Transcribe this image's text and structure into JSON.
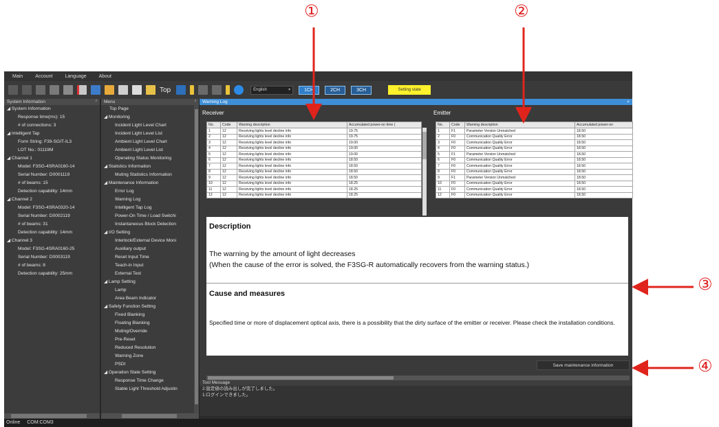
{
  "annotations": {
    "marker1": "①",
    "marker2": "②",
    "marker3": "③",
    "marker4": "④",
    "arrow_color": "#e0241c"
  },
  "menubar": {
    "items": [
      "Main",
      "Account",
      "Language",
      "About"
    ]
  },
  "toolbar": {
    "top_label": "Top",
    "language": "English",
    "ch1": "1CH",
    "ch2": "2CH",
    "ch3": "3CH",
    "setting_state": "Setting state"
  },
  "system_panel": {
    "title": "System Information",
    "items": [
      {
        "text": "◢ System Information",
        "indent": 0
      },
      {
        "text": "Response time(ms): 15",
        "indent": 2
      },
      {
        "text": "# of connections: 3",
        "indent": 2
      },
      {
        "text": "◢ Intelligent Tap",
        "indent": 0
      },
      {
        "text": "Form String: F39-SGIT-IL3",
        "indent": 2
      },
      {
        "text": "LOT No.: 01119M",
        "indent": 2
      },
      {
        "text": "◢ Channel 1",
        "indent": 0
      },
      {
        "text": "Model: F3SG-4SRA0160-14",
        "indent": 2
      },
      {
        "text": "Serial Number: D0001119",
        "indent": 2
      },
      {
        "text": "# of beams: 15",
        "indent": 2
      },
      {
        "text": "Detection capability: 14mm",
        "indent": 2
      },
      {
        "text": "◢ Channel 2",
        "indent": 0
      },
      {
        "text": "Model: F3SG-4SRA0320-14",
        "indent": 2
      },
      {
        "text": "Serial Number: D0002119",
        "indent": 2
      },
      {
        "text": "# of beams: 31",
        "indent": 2
      },
      {
        "text": "Detection capability: 14mm",
        "indent": 2
      },
      {
        "text": "◢ Channel 3",
        "indent": 0
      },
      {
        "text": "Model: F3SG-4SRA0160-25",
        "indent": 2
      },
      {
        "text": "Serial Number: D0003119",
        "indent": 2
      },
      {
        "text": "# of beams: 8",
        "indent": 2
      },
      {
        "text": "Detection capability: 25mm",
        "indent": 2
      }
    ]
  },
  "menu_panel": {
    "title": "Menu",
    "items": [
      {
        "text": "Top Page",
        "indent": 1
      },
      {
        "text": "◢ Monitoring",
        "indent": 0
      },
      {
        "text": "Incident Light Level Chart",
        "indent": 2
      },
      {
        "text": "Incident Light Level List",
        "indent": 2
      },
      {
        "text": "Ambient Light Level Chart",
        "indent": 2
      },
      {
        "text": "Ambient Light Level List",
        "indent": 2
      },
      {
        "text": "Operating Status Monitoring",
        "indent": 2
      },
      {
        "text": "◢ Statistics Information",
        "indent": 0
      },
      {
        "text": "Muting Statistics Information",
        "indent": 2
      },
      {
        "text": "◢ Maintenance Information",
        "indent": 0
      },
      {
        "text": "Error Log",
        "indent": 2
      },
      {
        "text": "Warning Log",
        "indent": 2
      },
      {
        "text": "Intelligent Tap Log",
        "indent": 2
      },
      {
        "text": "Power-On Time / Load Switchi",
        "indent": 2
      },
      {
        "text": "Instantaneous Block Detection",
        "indent": 2
      },
      {
        "text": "◢ I/O Setting",
        "indent": 0
      },
      {
        "text": "Interlock/External Device Moni",
        "indent": 2
      },
      {
        "text": "Auxiliary output",
        "indent": 2
      },
      {
        "text": "Reset Input Time",
        "indent": 2
      },
      {
        "text": "Teach-in Input",
        "indent": 2
      },
      {
        "text": "External Test",
        "indent": 2
      },
      {
        "text": "◢ Lamp Setting",
        "indent": 0
      },
      {
        "text": "Lamp",
        "indent": 2
      },
      {
        "text": "Area Beam Indicator",
        "indent": 2
      },
      {
        "text": "◢ Safety Function Setting",
        "indent": 0
      },
      {
        "text": "Fixed Blanking",
        "indent": 2
      },
      {
        "text": "Floating Blanking",
        "indent": 2
      },
      {
        "text": "Muting/Override",
        "indent": 2
      },
      {
        "text": "Pre-Reset",
        "indent": 2
      },
      {
        "text": "Reduced Resolution",
        "indent": 2
      },
      {
        "text": "Warning Zone",
        "indent": 2
      },
      {
        "text": "PSDI",
        "indent": 2
      },
      {
        "text": "◢ Operation State Setting",
        "indent": 0
      },
      {
        "text": "Response Time Change",
        "indent": 2
      },
      {
        "text": "Stable Light Threshold Adjustin",
        "indent": 2
      }
    ]
  },
  "warning_log": {
    "title": "Warning Log",
    "receiver": {
      "label": "Receiver",
      "columns": [
        "No.",
        "Code",
        "Warning description",
        "Accumulated power-on time ("
      ],
      "rows": [
        [
          "1",
          "12",
          "Receiving lights level decline info",
          "19.75"
        ],
        [
          "2",
          "12",
          "Receiving lights level decline info",
          "19.75"
        ],
        [
          "3",
          "12",
          "Receiving lights level decline info",
          "19.00"
        ],
        [
          "4",
          "12",
          "Receiving lights level decline info",
          "19.00"
        ],
        [
          "5",
          "12",
          "Receiving lights level decline info",
          "19.00"
        ],
        [
          "6",
          "12",
          "Receiving lights level decline info",
          "18.50"
        ],
        [
          "7",
          "12",
          "Receiving lights level decline info",
          "18.50"
        ],
        [
          "8",
          "12",
          "Receiving lights level decline info",
          "18.50"
        ],
        [
          "9",
          "12",
          "Receiving lights level decline info",
          "18.50"
        ],
        [
          "10",
          "12",
          "Receiving lights level decline info",
          "18.25"
        ],
        [
          "11",
          "12",
          "Receiving lights level decline info",
          "18.25"
        ],
        [
          "12",
          "12",
          "Receiving lights level decline info",
          "18.25"
        ]
      ]
    },
    "emitter": {
      "label": "Emitter",
      "columns": [
        "No.",
        "Code",
        "Warning description",
        "Accumulated power-on"
      ],
      "rows": [
        [
          "1",
          "F1",
          "Parameter Version Unmatched",
          "18.50"
        ],
        [
          "2",
          "F0",
          "Communication Quality Error",
          "18.50"
        ],
        [
          "3",
          "F0",
          "Communication Quality Error",
          "18.50"
        ],
        [
          "4",
          "F0",
          "Communication Quality Error",
          "18.50"
        ],
        [
          "5",
          "F1",
          "Parameter Version Unmatched",
          "18.50"
        ],
        [
          "6",
          "F0",
          "Communication Quality Error",
          "18.50"
        ],
        [
          "7",
          "F0",
          "Communication Quality Error",
          "18.50"
        ],
        [
          "8",
          "F0",
          "Communication Quality Error",
          "18.50"
        ],
        [
          "9",
          "F1",
          "Parameter Version Unmatched",
          "18.50"
        ],
        [
          "10",
          "F0",
          "Communication Quality Error",
          "18.50"
        ],
        [
          "11",
          "F0",
          "Communication Quality Error",
          "18.50"
        ],
        [
          "12",
          "F0",
          "Communication Quality Error",
          "18.50"
        ]
      ]
    },
    "description": {
      "heading": "Description",
      "line1": "The warning by the amount of light decreases",
      "line2": "(When the cause of the error is solved, the F3SG-R automatically recovers from the warning status.)",
      "cause_heading": "Cause and measures",
      "cause_text": "Specified time or more of displacement optical axis, there is a possibility that the dirty surface of the emitter or receiver. Please check the installation conditions."
    },
    "save_button": "Save maintenance information"
  },
  "tool_message": {
    "title": "Tool Message",
    "messages": [
      "2:設定値の読み出しが完了しました。",
      "1:ログインできました。"
    ]
  },
  "status_bar": {
    "online": "Online",
    "port": "COM:COM3"
  }
}
